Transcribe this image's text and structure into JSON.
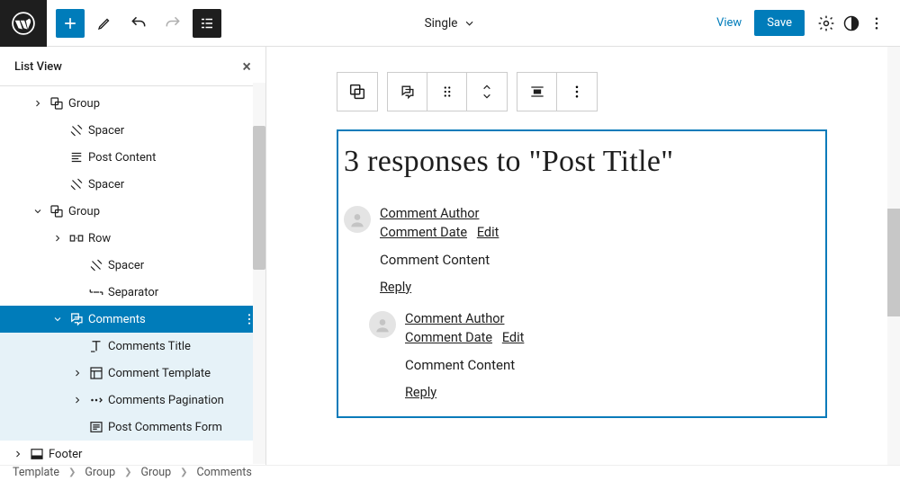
{
  "topbar": {
    "doc_title": "Single",
    "view": "View",
    "save": "Save"
  },
  "sidebar": {
    "title": "List View",
    "items": [
      {
        "indent": 0,
        "caret": "right",
        "icon": "group",
        "label": "Group"
      },
      {
        "indent": 1,
        "caret": "",
        "icon": "spacer",
        "label": "Spacer"
      },
      {
        "indent": 1,
        "caret": "",
        "icon": "postcontent",
        "label": "Post Content"
      },
      {
        "indent": 1,
        "caret": "",
        "icon": "spacer",
        "label": "Spacer"
      },
      {
        "indent": 0,
        "caret": "down",
        "icon": "group",
        "label": "Group"
      },
      {
        "indent": 1,
        "caret": "right",
        "icon": "row",
        "label": "Row"
      },
      {
        "indent": 2,
        "caret": "",
        "icon": "spacer",
        "label": "Spacer"
      },
      {
        "indent": 2,
        "caret": "",
        "icon": "separator",
        "label": "Separator"
      },
      {
        "indent": 1,
        "caret": "down",
        "icon": "comments",
        "label": "Comments",
        "selected": true
      },
      {
        "indent": 2,
        "caret": "",
        "icon": "ctitle",
        "label": "Comments Title",
        "child": true
      },
      {
        "indent": 2,
        "caret": "right",
        "icon": "ctemplate",
        "label": "Comment Template",
        "child": true
      },
      {
        "indent": 2,
        "caret": "right",
        "icon": "cpagination",
        "label": "Comments Pagination",
        "child": true
      },
      {
        "indent": 2,
        "caret": "",
        "icon": "cform",
        "label": "Post Comments Form",
        "child": true
      },
      {
        "indent": -1,
        "caret": "right",
        "icon": "footer",
        "label": "Footer"
      }
    ]
  },
  "canvas": {
    "title": "3 responses to \"Post Title\"",
    "author": "Comment Author",
    "date": "Comment Date",
    "edit": "Edit",
    "content": "Comment Content",
    "reply": "Reply"
  },
  "crumb": [
    "Template",
    "Group",
    "Group",
    "Comments"
  ]
}
